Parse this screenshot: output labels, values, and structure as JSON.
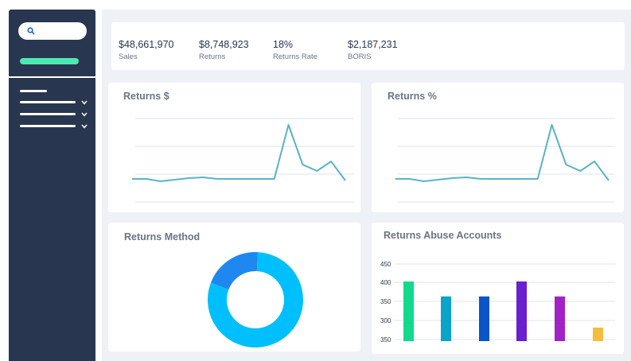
{
  "sidebar": {
    "search_icon": "search-icon",
    "nav_items": 3
  },
  "kpis": [
    {
      "value": "$48,661,970",
      "label": "Sales"
    },
    {
      "value": "$8,748,923",
      "label": "Returns"
    },
    {
      "value": "18%",
      "label": "Returns Rate"
    },
    {
      "value": "$2,187,231",
      "label": "BORIS"
    }
  ],
  "cards": {
    "returns_dollar": {
      "title": "Returns $"
    },
    "returns_pct": {
      "title": "Returns %"
    },
    "returns_method": {
      "title": "Returns Method"
    },
    "abuse": {
      "title": "Returns Abuse Accounts"
    }
  },
  "colors": {
    "sidebar": "#28364f",
    "accent_green": "#4de8b2",
    "line": "#5ab3c8",
    "donut_primary": "#00bfff",
    "donut_secondary": "#1e88f0"
  },
  "chart_data": [
    {
      "type": "line",
      "title": "Returns $",
      "series": [
        {
          "values": [
            22,
            22,
            19,
            21,
            23,
            24,
            22,
            22,
            22,
            22,
            22,
            90,
            40,
            32,
            44,
            20
          ]
        }
      ],
      "grid": true
    },
    {
      "type": "line",
      "title": "Returns %",
      "series": [
        {
          "values": [
            22,
            22,
            19,
            21,
            23,
            24,
            22,
            22,
            22,
            22,
            22,
            90,
            40,
            32,
            44,
            20
          ]
        }
      ],
      "grid": true
    },
    {
      "type": "pie",
      "title": "Returns Method",
      "slices": [
        {
          "value": 80,
          "color": "#00bfff"
        },
        {
          "value": 20,
          "color": "#1e88f0"
        }
      ]
    },
    {
      "type": "bar",
      "title": "Returns Abuse Accounts",
      "tick_labels": [
        "450",
        "400",
        "350",
        "300",
        "350"
      ],
      "values": [
        400,
        362,
        362,
        400,
        362,
        283
      ],
      "colors": [
        "#12d98c",
        "#0aa4cb",
        "#0a55c8",
        "#6a1fd0",
        "#a322c8",
        "#f2be3c"
      ],
      "grid": true
    }
  ]
}
